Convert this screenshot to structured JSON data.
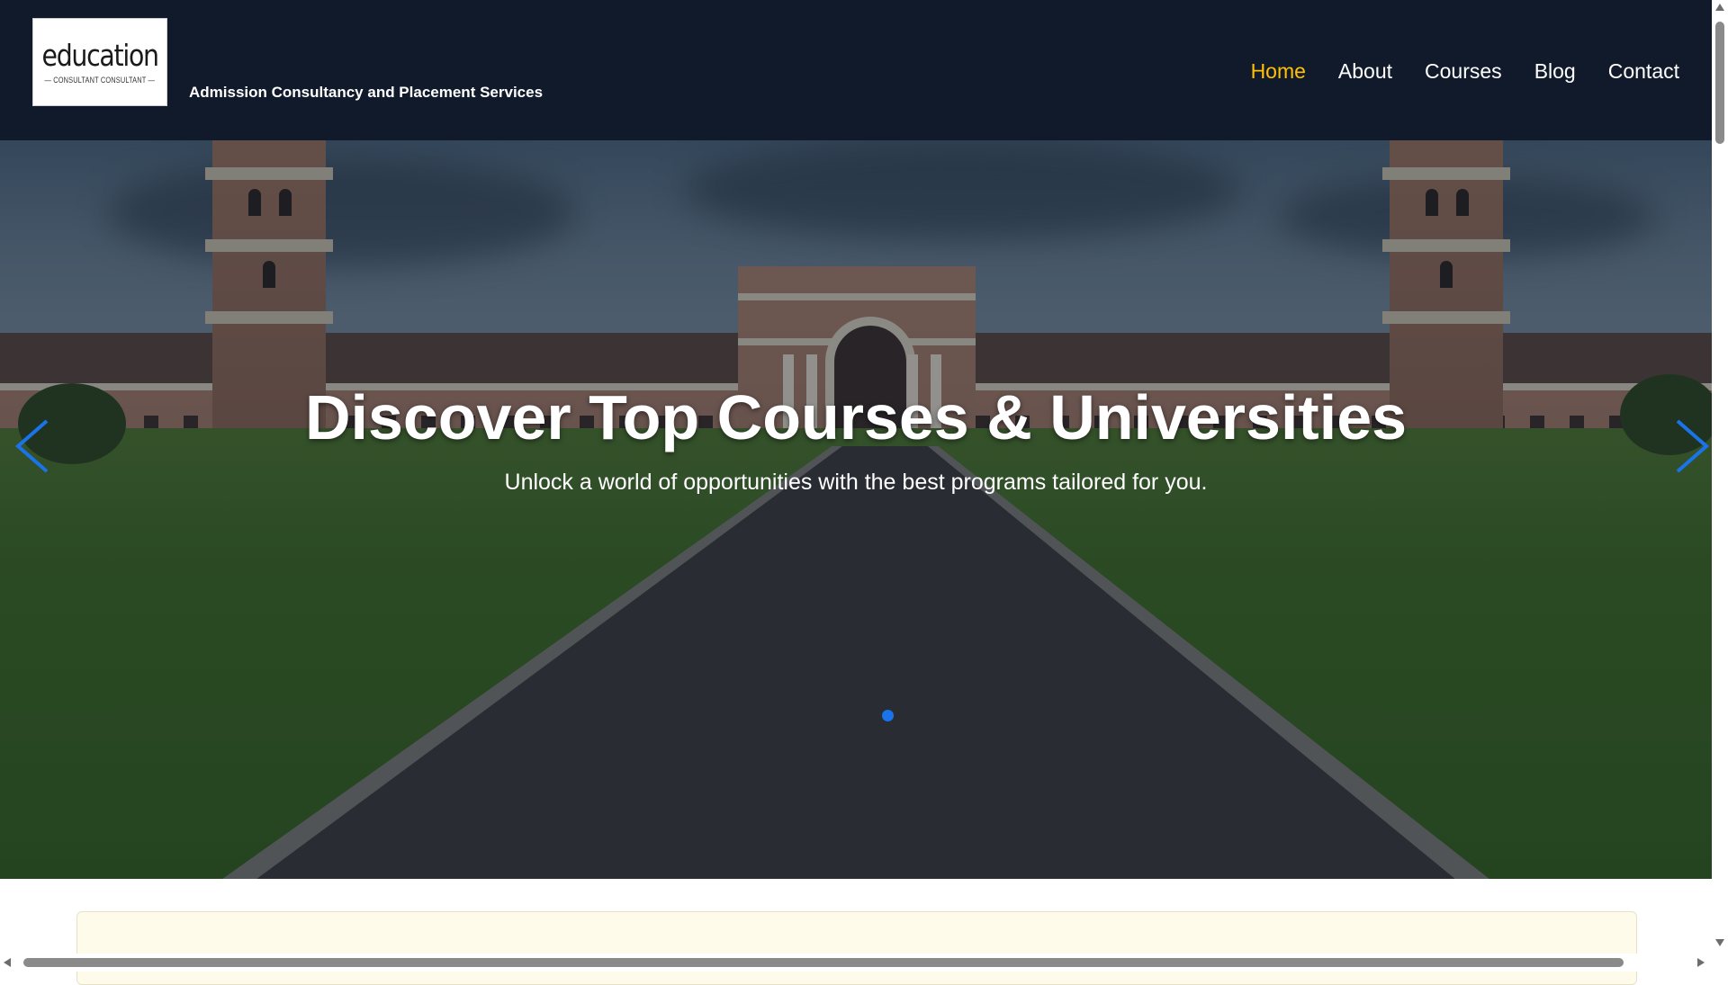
{
  "brand": {
    "logo_word": "education",
    "logo_sub": "— CONSULTANT CONSULTANT —",
    "tagline": "Admission Consultancy and Placement Services"
  },
  "nav": {
    "items": [
      {
        "label": "Home",
        "active": true
      },
      {
        "label": "About",
        "active": false
      },
      {
        "label": "Courses",
        "active": false
      },
      {
        "label": "Blog",
        "active": false
      },
      {
        "label": "Contact",
        "active": false
      }
    ]
  },
  "hero": {
    "title": "Discover Top Courses & Universities",
    "subtitle": "Unlock a world of opportunities with the best programs tailored for you.",
    "prev_icon": "chevron-left-icon",
    "next_icon": "chevron-right-icon",
    "slide_count": 1,
    "active_slide": 1
  },
  "colors": {
    "header_bg": "#111a2b",
    "nav_active": "#ffc107",
    "carousel_accent": "#1a73e8",
    "card_bg": "#fffbea"
  }
}
